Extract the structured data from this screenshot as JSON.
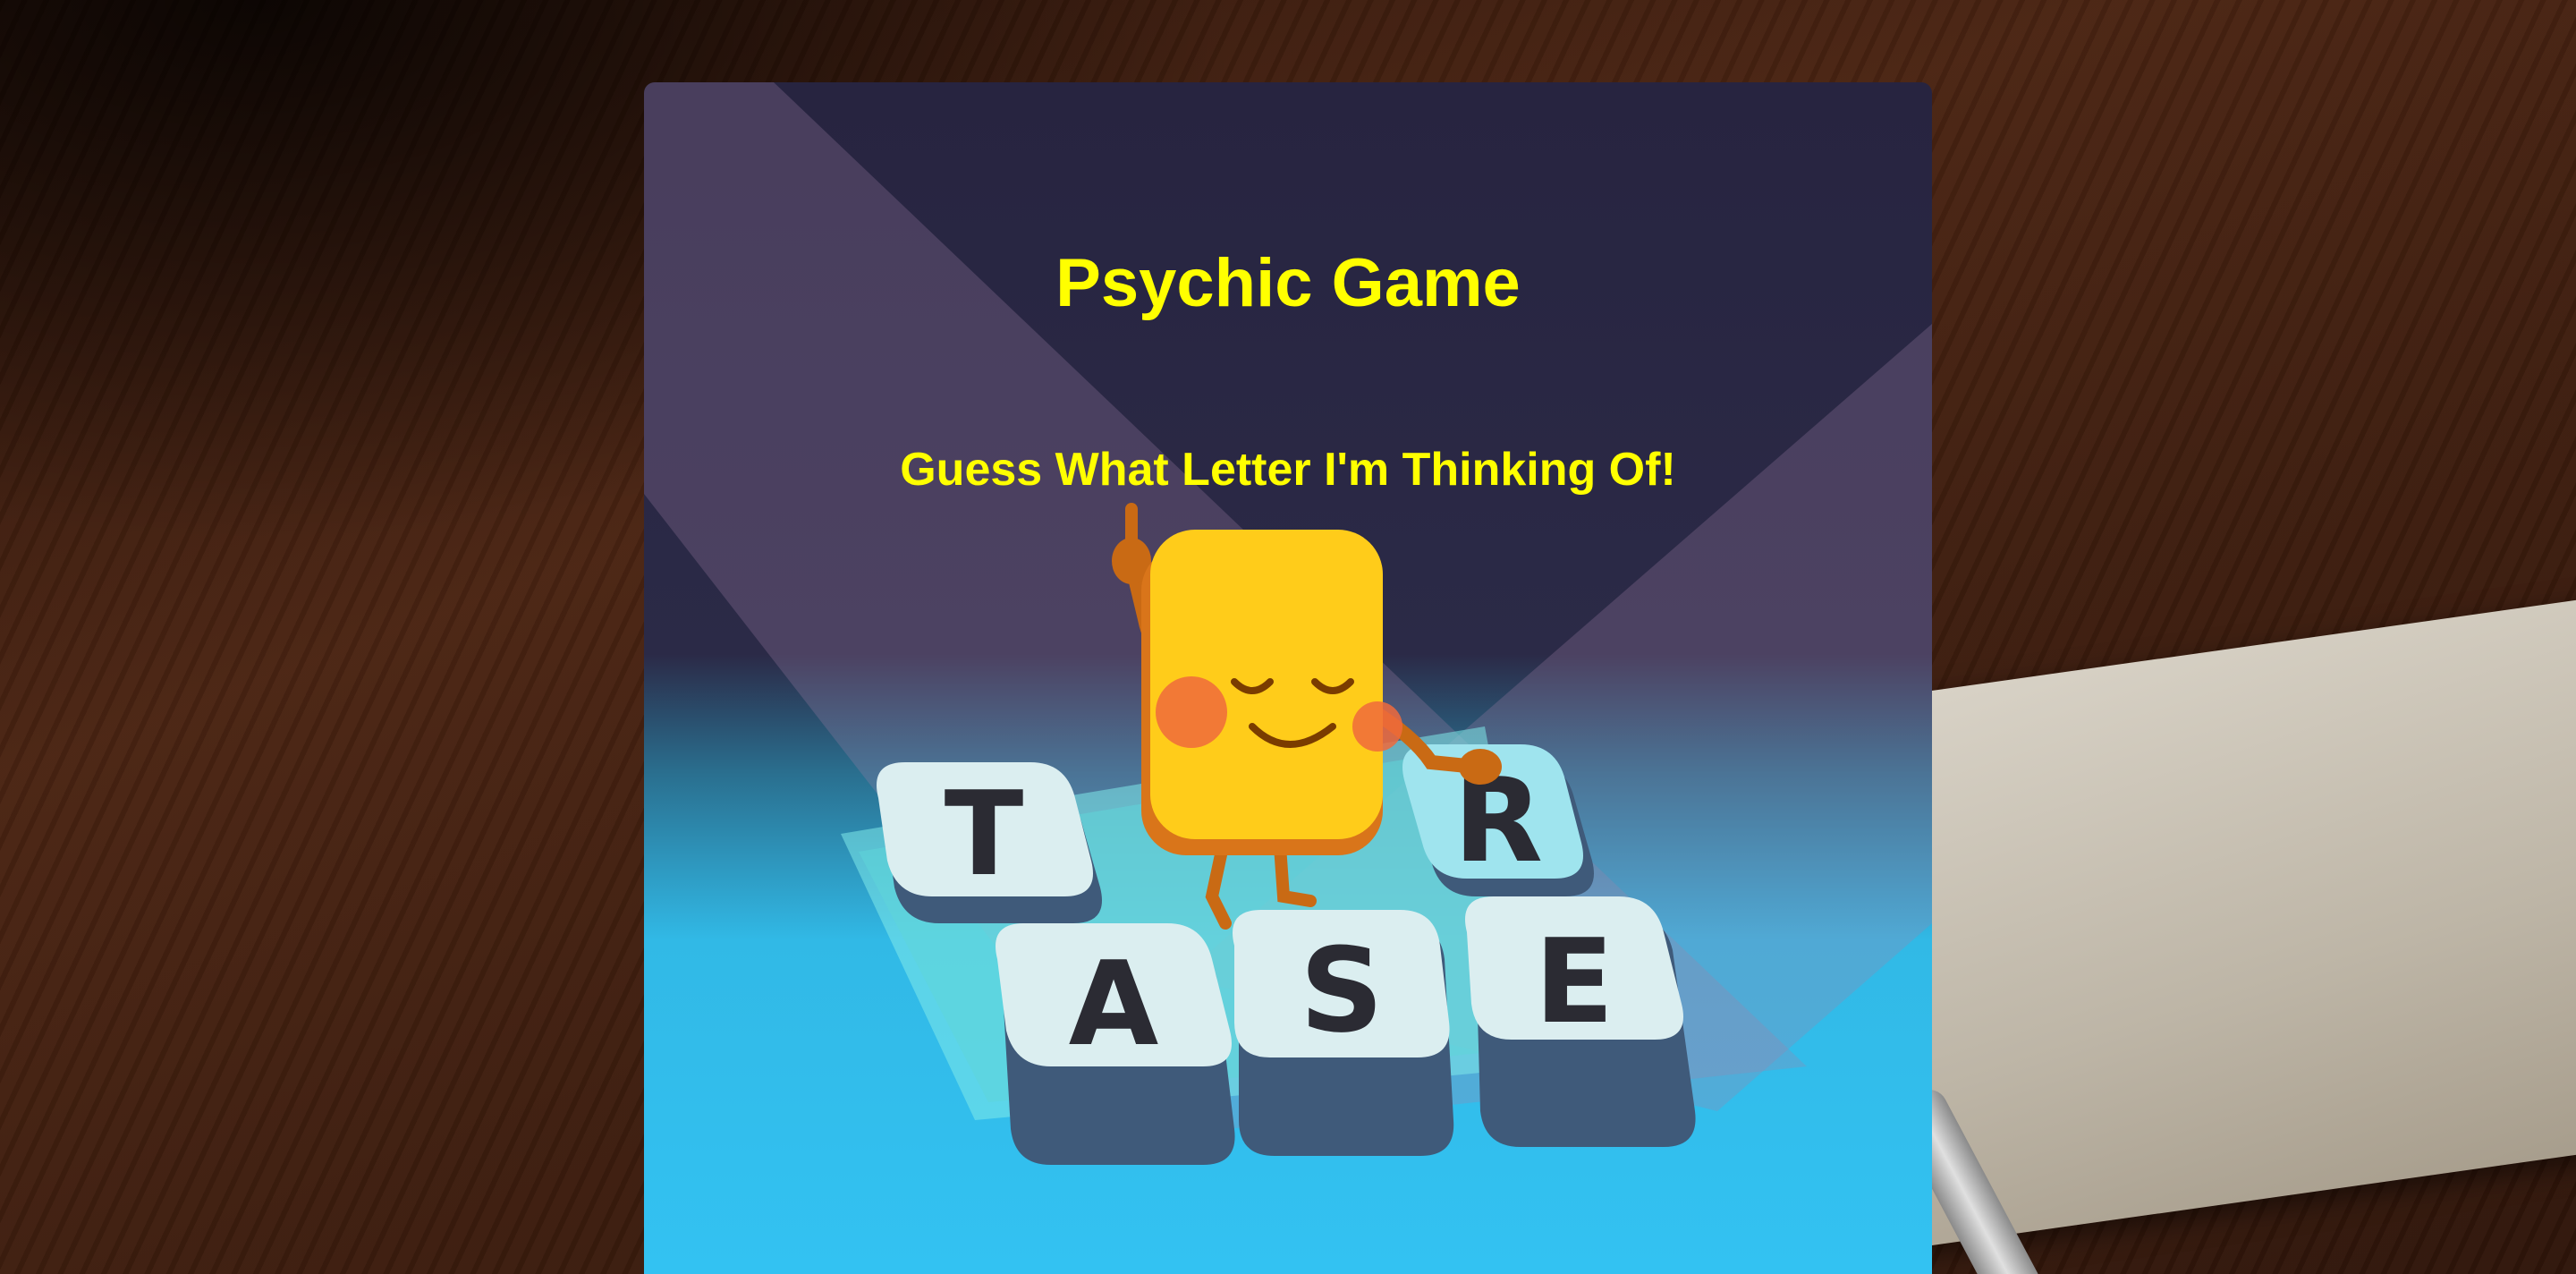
{
  "game": {
    "title": "Psychic Game",
    "subtitle": "Guess What Letter I'm Thinking Of!"
  },
  "tiles": {
    "top_left": "T",
    "top_right": "R",
    "bottom_left": "A",
    "bottom_middle": "S",
    "bottom_right": "E"
  },
  "colors": {
    "title": "#ffff00",
    "card_top": "#272440",
    "card_bottom": "#33c2f2",
    "character": "#ffcc1a"
  }
}
